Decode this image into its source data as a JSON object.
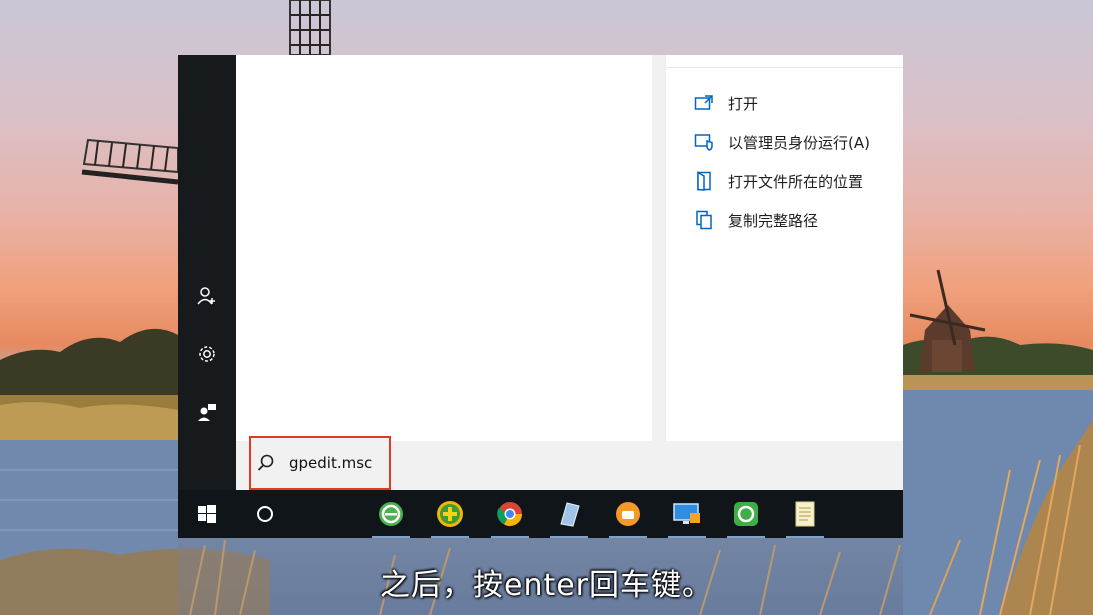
{
  "search": {
    "query": "gpedit.msc"
  },
  "preview_actions": [
    {
      "label": "打开",
      "icon": "open-icon"
    },
    {
      "label": "以管理员身份运行(A)",
      "icon": "shield-admin-icon"
    },
    {
      "label": "打开文件所在的位置",
      "icon": "folder-location-icon"
    },
    {
      "label": "复制完整路径",
      "icon": "copy-path-icon"
    }
  ],
  "sidebar_icons": [
    "user-add-icon",
    "gear-icon",
    "feedback-user-icon"
  ],
  "taskbar_icons": [
    "windows-start-icon",
    "cortana-circle-icon",
    "ie-browser-icon",
    "plus-app-icon",
    "chrome-icon",
    "notepad-tilt-icon",
    "orange-app-icon",
    "remote-desktop-icon",
    "green-app-icon",
    "document-icon"
  ],
  "caption": {
    "text": "之后，按enter回车键。"
  },
  "colors": {
    "accent": "#0067c0",
    "highlight_border": "#e23a22",
    "taskbar": "#10151a",
    "start_rail": "#161a1c"
  }
}
